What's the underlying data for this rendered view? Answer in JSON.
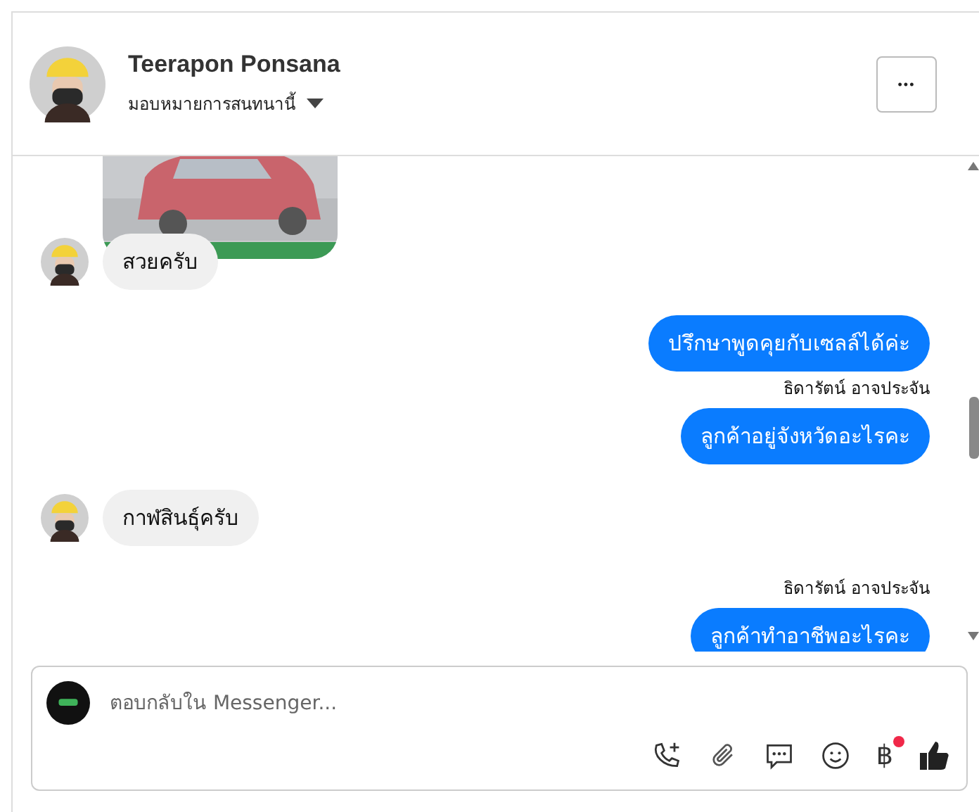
{
  "header": {
    "name": "Teerapon Ponsana",
    "assign_label": "มอบหมายการสนทนานี้",
    "more_button": "•••"
  },
  "messages": [
    {
      "kind": "picture"
    },
    {
      "kind": "incoming",
      "text": "สวยครับ"
    },
    {
      "kind": "outgoing",
      "text": "ปรึกษาพูดคุยกับเซลล์ได้ค่ะ"
    },
    {
      "kind": "sender",
      "text": "ธิดารัตน์ อาจประจัน"
    },
    {
      "kind": "outgoing",
      "text": "ลูกค้าอยู่จังหวัดอะไรคะ"
    },
    {
      "kind": "incoming",
      "text": "กาฬสินธุ์ครับ"
    },
    {
      "kind": "sender",
      "text": "ธิดารัตน์ อาจประจัน"
    },
    {
      "kind": "outgoing",
      "text": "ลูกค้าทำอาชีพอะไรคะ"
    }
  ],
  "composer": {
    "placeholder": "ตอบกลับใน Messenger...",
    "currency_symbol": "฿",
    "currency_badge": true
  }
}
